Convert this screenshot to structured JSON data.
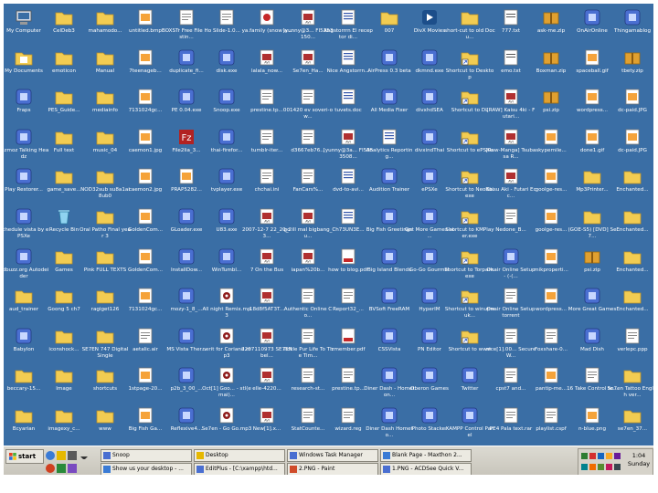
{
  "desktop": {
    "background": "#3a6ea5",
    "icons": [
      {
        "label": "My Computer",
        "icon": "computer-icon"
      },
      {
        "label": "CelDeb3",
        "icon": "folder-icon"
      },
      {
        "label": "mahamodo...",
        "icon": "folder-icon"
      },
      {
        "label": "untitled.bmp",
        "icon": "image-file-icon"
      },
      {
        "label": "BOXSTr Free File Hostin...",
        "icon": "document-icon"
      },
      {
        "label": "Slide-1.0...",
        "icon": "document-icon"
      },
      {
        "label": "ya.family (snow a...",
        "icon": "media-file-icon"
      },
      {
        "label": "[yunny@3... FI5353150...",
        "icon": "video-file-icon"
      },
      {
        "label": "Angstorrrn El receptor di...",
        "icon": "word-document-icon"
      },
      {
        "label": "007",
        "icon": "folder-icon"
      },
      {
        "label": "DivX Movies",
        "icon": "divx-icon"
      },
      {
        "label": "short-cut to old Docu...",
        "icon": "folder-icon"
      },
      {
        "label": "777.txt",
        "icon": "text-file-icon"
      },
      {
        "label": "ask-me.zip",
        "icon": "zip-file-icon"
      },
      {
        "label": "OnAirOnline",
        "icon": "app-icon"
      },
      {
        "label": "Thingamablog",
        "icon": "app-icon"
      },
      {
        "label": "My Documents",
        "icon": "documents-folder-icon"
      },
      {
        "label": "emoticon",
        "icon": "folder-icon"
      },
      {
        "label": "Manual",
        "icon": "folder-icon"
      },
      {
        "label": "7teenageb...",
        "icon": "image-file-icon"
      },
      {
        "label": "duplicate_fi...",
        "icon": "app-icon"
      },
      {
        "label": "disk.exe",
        "icon": "app-icon"
      },
      {
        "label": "lalala_now...",
        "icon": "video-file-icon"
      },
      {
        "label": "Se7en_Ha...",
        "icon": "video-file-icon"
      },
      {
        "label": "Nice Angstorrn...",
        "icon": "word-document-icon"
      },
      {
        "label": "AirPress 0.3 beta",
        "icon": "app-icon"
      },
      {
        "label": "dkmnd.exe",
        "icon": "app-icon"
      },
      {
        "label": "Shortcut to Desktop",
        "icon": "shortcut-icon"
      },
      {
        "label": "emo.txt",
        "icon": "text-file-icon"
      },
      {
        "label": "Boxman.zip",
        "icon": "zip-file-icon"
      },
      {
        "label": "spaceball.gif",
        "icon": "image-file-icon"
      },
      {
        "label": "tbety.zip",
        "icon": "zip-file-icon"
      },
      {
        "label": "Fraps",
        "icon": "app-icon"
      },
      {
        "label": "PES_Guide...",
        "icon": "folder-icon"
      },
      {
        "label": "mediainfo",
        "icon": "folder-icon"
      },
      {
        "label": "7131024gc...",
        "icon": "image-file-icon"
      },
      {
        "label": "PE 0.04.exe",
        "icon": "app-icon"
      },
      {
        "label": "Snoop.exe",
        "icon": "app-icon"
      },
      {
        "label": "prestine.tp...",
        "icon": "document-icon"
      },
      {
        "label": "001420 ev soveri-ow...",
        "icon": "document-icon"
      },
      {
        "label": "tuvets.doc",
        "icon": "word-document-icon"
      },
      {
        "label": "All Media Fixer",
        "icon": "app-icon"
      },
      {
        "label": "divxhdSEA",
        "icon": "app-icon"
      },
      {
        "label": "Shortcut to DL",
        "icon": "shortcut-icon"
      },
      {
        "label": "[RAW] Kaisu 4ki - Futari...",
        "icon": "video-file-icon"
      },
      {
        "label": "psi.zip",
        "icon": "zip-file-icon"
      },
      {
        "label": "wordpress...",
        "icon": "image-file-icon"
      },
      {
        "label": "dc-paid.JPG",
        "icon": "image-file-icon"
      },
      {
        "label": "Gizmoz Talking Headz",
        "icon": "app-icon"
      },
      {
        "label": "Full text",
        "icon": "folder-icon"
      },
      {
        "label": "music_04",
        "icon": "folder-icon"
      },
      {
        "label": "caemon1.jpg",
        "icon": "image-file-icon"
      },
      {
        "label": "File2lia_3...",
        "icon": "filezilla-icon"
      },
      {
        "label": "thai-firefor...",
        "icon": "app-icon"
      },
      {
        "label": "tumblr-iter...",
        "icon": "document-icon"
      },
      {
        "label": "d3667eb76...",
        "icon": "document-icon"
      },
      {
        "label": "[yunny@3a... FI5353508...",
        "icon": "video-file-icon"
      },
      {
        "label": "Analytics Reporting...",
        "icon": "word-document-icon"
      },
      {
        "label": "divxindThai",
        "icon": "app-icon"
      },
      {
        "label": "Shortcut to ePSXe",
        "icon": "shortcut-icon"
      },
      {
        "label": "[Raw-Manga] Tsubasa R...",
        "icon": "video-file-icon"
      },
      {
        "label": "skypemile...",
        "icon": "image-file-icon"
      },
      {
        "label": "done1.gif",
        "icon": "image-file-icon"
      },
      {
        "label": "dc-paid.JPG",
        "icon": "image-file-icon"
      },
      {
        "label": "Play Restorer...",
        "icon": "app-icon"
      },
      {
        "label": "game_save...",
        "icon": "folder-icon"
      },
      {
        "label": "NOD32sub su8a1ai8ub0",
        "icon": "folder-icon"
      },
      {
        "label": "caemon2.jpg",
        "icon": "image-file-icon"
      },
      {
        "label": "PRAP5282...",
        "icon": "image-file-icon"
      },
      {
        "label": "tvplayer.exe",
        "icon": "app-icon"
      },
      {
        "label": "chchai.ini",
        "icon": "document-icon"
      },
      {
        "label": "FanCars%...",
        "icon": "document-icon"
      },
      {
        "label": "dvd-to-avi...",
        "icon": "word-document-icon"
      },
      {
        "label": "Audition Trainer",
        "icon": "app-icon"
      },
      {
        "label": "ePSXe",
        "icon": "app-icon"
      },
      {
        "label": "Shortcut to NeoBb.exe",
        "icon": "shortcut-icon"
      },
      {
        "label": "Kaisu Aki - Futari Ecc...",
        "icon": "video-file-icon"
      },
      {
        "label": "goolge-res...",
        "icon": "image-file-icon"
      },
      {
        "label": "Mp3Printer...",
        "icon": "folder-icon"
      },
      {
        "label": "Enchanted...",
        "icon": "folder-icon"
      },
      {
        "label": "Schedule vista by ePSXe",
        "icon": "app-icon"
      },
      {
        "label": "Recycle Bin",
        "icon": "recycle-bin-icon"
      },
      {
        "label": "Oral Patho Final year 3",
        "icon": "folder-icon"
      },
      {
        "label": "GoldenCom...",
        "icon": "image-file-icon"
      },
      {
        "label": "GLoader.exe",
        "icon": "app-icon"
      },
      {
        "label": "U83.exe",
        "icon": "app-icon"
      },
      {
        "label": "2007-12-7 22_20_23...",
        "icon": "video-file-icon"
      },
      {
        "label": "go ill mal bigbang_u...",
        "icon": "video-file-icon"
      },
      {
        "label": "Ch73UN3E...",
        "icon": "word-document-icon"
      },
      {
        "label": "Big Fish Greetings",
        "icon": "app-icon"
      },
      {
        "label": "Get More Games at ...",
        "icon": "app-icon"
      },
      {
        "label": "Shortcut to KMPlayer.exe",
        "icon": "shortcut-icon"
      },
      {
        "label": "Nedone_B...",
        "icon": "document-icon"
      },
      {
        "label": "goolge-res...",
        "icon": "image-file-icon"
      },
      {
        "label": "(GOE-S5) [DVD] Se7...",
        "icon": "folder-icon"
      },
      {
        "label": "Enchanted...",
        "icon": "folder-icon"
      },
      {
        "label": "Adbuzz.org Autodeider",
        "icon": "app-icon"
      },
      {
        "label": "Games",
        "icon": "folder-icon"
      },
      {
        "label": "Pink FULL TEXTS",
        "icon": "folder-icon"
      },
      {
        "label": "GoldenCom...",
        "icon": "image-file-icon"
      },
      {
        "label": "InstallDow...",
        "icon": "app-icon"
      },
      {
        "label": "WinTumbl...",
        "icon": "app-icon"
      },
      {
        "label": "7 On the Bus",
        "icon": "video-file-icon"
      },
      {
        "label": "iapan%20b...",
        "icon": "video-file-icon"
      },
      {
        "label": "how to blog.pdf",
        "icon": "pdf-file-icon"
      },
      {
        "label": "Big Island Blends",
        "icon": "app-icon"
      },
      {
        "label": "Go-Go Gourmet",
        "icon": "app-icon"
      },
      {
        "label": "Shortcut to Torpark.exe",
        "icon": "shortcut-icon"
      },
      {
        "label": "Onair Online Setup - (-(...",
        "icon": "app-icon"
      },
      {
        "label": "mikproperti...",
        "icon": "image-file-icon"
      },
      {
        "label": "psi.zip",
        "icon": "zip-file-icon"
      },
      {
        "label": "Enchanted...",
        "icon": "folder-icon"
      },
      {
        "label": "aud_trainer",
        "icon": "folder-icon"
      },
      {
        "label": "Goong 5 ch7",
        "icon": "folder-icon"
      },
      {
        "label": "ragiget126",
        "icon": "folder-icon"
      },
      {
        "label": "7131024gc...",
        "icon": "image-file-icon"
      },
      {
        "label": "mozy-1_8_...",
        "icon": "app-icon"
      },
      {
        "label": "All night Remix.mp3",
        "icon": "audio-file-icon"
      },
      {
        "label": "18d8f5AT3T...",
        "icon": "video-file-icon"
      },
      {
        "label": "Authentic Online Co...",
        "icon": "document-icon"
      },
      {
        "label": "Report32_...",
        "icon": "document-icon"
      },
      {
        "label": "BVSoft FreeRAM",
        "icon": "app-icon"
      },
      {
        "label": "HyperIM",
        "icon": "app-icon"
      },
      {
        "label": "Shortcut to winupwuk...",
        "icon": "shortcut-icon"
      },
      {
        "label": "Onair Online Setup torrent",
        "icon": "document-icon"
      },
      {
        "label": "wordpress...",
        "icon": "image-file-icon"
      },
      {
        "label": "More Great Games",
        "icon": "app-icon"
      },
      {
        "label": "Enchanted...",
        "icon": "folder-icon"
      },
      {
        "label": "Babylon",
        "icon": "app-icon"
      },
      {
        "label": "iconshock...",
        "icon": "folder-icon"
      },
      {
        "label": "SE7EN 747 Digital Single",
        "icon": "folder-icon"
      },
      {
        "label": "aetalic.air",
        "icon": "document-icon"
      },
      {
        "label": "MS Vista Ther...",
        "icon": "app-icon"
      },
      {
        "label": "nerit for Coriand.mp3",
        "icon": "audio-file-icon"
      },
      {
        "label": "2207110973 SE7EN bel...",
        "icon": "video-file-icon"
      },
      {
        "label": "Tickle Pur Life To The Tim...",
        "icon": "document-icon"
      },
      {
        "label": "zmember.pdf",
        "icon": "pdf-file-icon"
      },
      {
        "label": "CSSVista",
        "icon": "app-icon"
      },
      {
        "label": "PN Editor",
        "icon": "app-icon"
      },
      {
        "label": "Shortcut to www",
        "icon": "shortcut-icon"
      },
      {
        "label": "nice[1].00... Secure W...",
        "icon": "document-icon"
      },
      {
        "label": "Foxshare-0...",
        "icon": "document-icon"
      },
      {
        "label": "Mad Dish",
        "icon": "app-icon"
      },
      {
        "label": "verlepc.ppp",
        "icon": "document-icon"
      },
      {
        "label": "beccary-15...",
        "icon": "folder-icon"
      },
      {
        "label": "Image",
        "icon": "folder-icon"
      },
      {
        "label": "shortcuts",
        "icon": "folder-icon"
      },
      {
        "label": "1stpage-20...",
        "icon": "image-file-icon"
      },
      {
        "label": "p2b_3_00_...",
        "icon": "app-icon"
      },
      {
        "label": "Oct[1] Goo... - stl(emai)...",
        "icon": "audio-file-icon"
      },
      {
        "label": "elle-4220...",
        "icon": "video-file-icon"
      },
      {
        "label": "research-st...",
        "icon": "document-icon"
      },
      {
        "label": "prestine.tp...",
        "icon": "document-icon"
      },
      {
        "label": "Diner Dash - Hometon...",
        "icon": "app-icon"
      },
      {
        "label": "Oberon Games",
        "icon": "app-icon"
      },
      {
        "label": "Twitter",
        "icon": "app-icon"
      },
      {
        "label": "cpst7 and...",
        "icon": "document-icon"
      },
      {
        "label": "pantip-me...",
        "icon": "image-file-icon"
      },
      {
        "label": "16 Take Control fe...",
        "icon": "document-icon"
      },
      {
        "label": "Se7en Tattoo English ver...",
        "icon": "folder-icon"
      },
      {
        "label": "Bcyarian",
        "icon": "folder-icon"
      },
      {
        "label": "imagexy_c...",
        "icon": "folder-icon"
      },
      {
        "label": "www",
        "icon": "folder-icon"
      },
      {
        "label": "Big Fish Ga...",
        "icon": "image-file-icon"
      },
      {
        "label": "Reflexive4...",
        "icon": "app-icon"
      },
      {
        "label": "Se7en - Go Go.mp3",
        "icon": "audio-file-icon"
      },
      {
        "label": "New[1].x...",
        "icon": "video-file-icon"
      },
      {
        "label": "StatCounte...",
        "icon": "document-icon"
      },
      {
        "label": "wizard.reg",
        "icon": "document-icon"
      },
      {
        "label": "Diner Dash Hometo...",
        "icon": "app-icon"
      },
      {
        "label": "Photo Stacker",
        "icon": "app-icon"
      },
      {
        "label": "XAMPP Control Panel",
        "icon": "app-icon"
      },
      {
        "label": "PE4 Pala text.rar",
        "icon": "document-icon"
      },
      {
        "label": "playlist.cspf",
        "icon": "document-icon"
      },
      {
        "label": "n-blue.png",
        "icon": "image-file-icon"
      },
      {
        "label": "se7en_37...",
        "icon": "folder-icon"
      }
    ]
  },
  "taskbar": {
    "start_label": "start",
    "row1": [
      {
        "label": "Snoop",
        "icon": "app-icon"
      },
      {
        "label": "Desktop",
        "icon": "folder-icon"
      },
      {
        "label": "Windows Task Manager",
        "icon": "app-icon"
      },
      {
        "label": "Blank Page - Maxthon 2...",
        "icon": "browser-icon"
      }
    ],
    "row2": [
      {
        "label": "Show us your desktop - ...",
        "icon": "browser-icon"
      },
      {
        "label": "EditPlus - [C:\\xampp\\htd...",
        "icon": "app-icon"
      },
      {
        "label": "2.PNG - Paint",
        "icon": "paint-icon"
      },
      {
        "label": "1.PNG - ACDSee Quick V...",
        "icon": "app-icon"
      }
    ],
    "clock": "1:04",
    "day": "Sunday"
  }
}
